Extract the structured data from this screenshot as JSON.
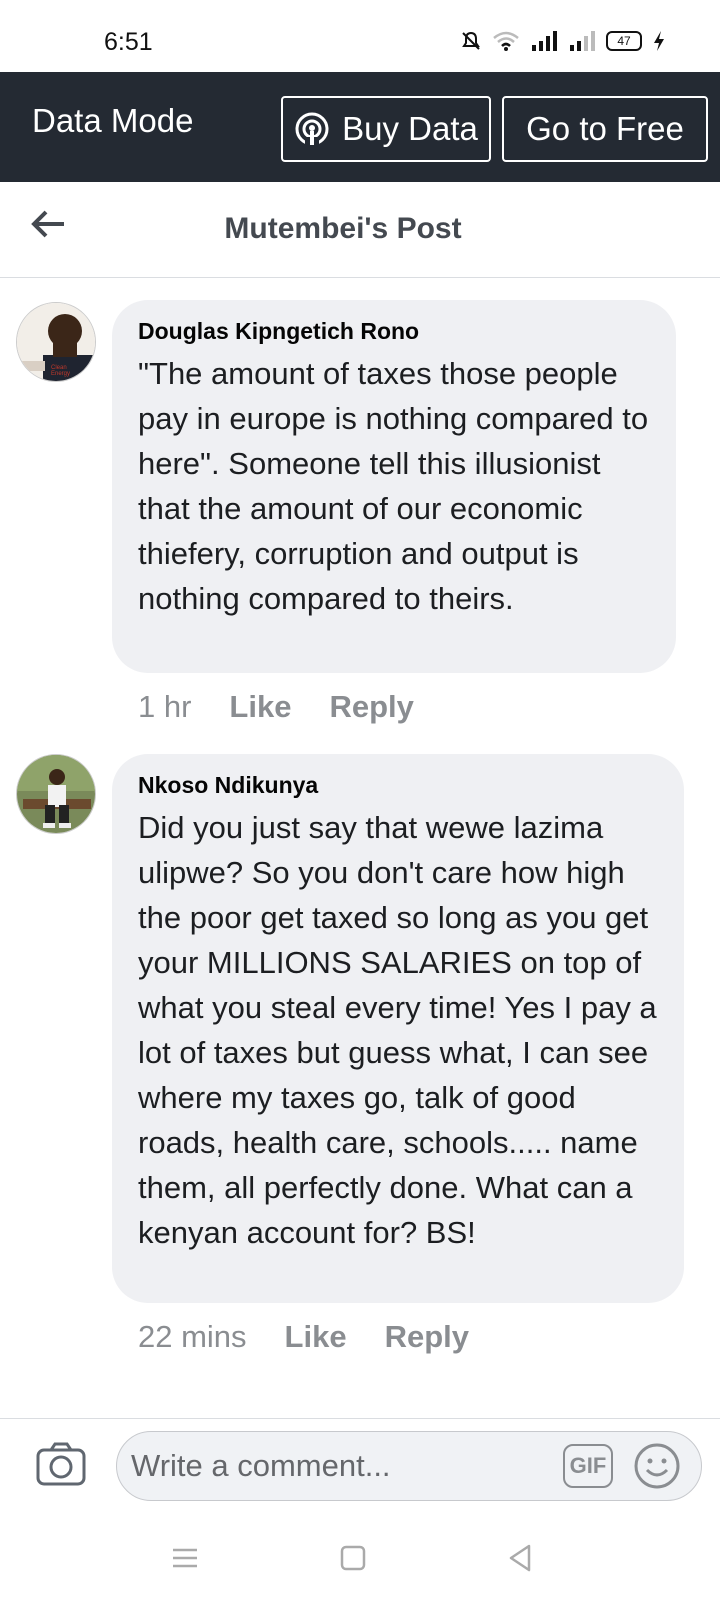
{
  "status_bar": {
    "time": "6:51",
    "battery": "47"
  },
  "data_mode": {
    "title": "Data Mode",
    "buy_label": "Buy Data",
    "free_label": "Go to Free"
  },
  "header": {
    "title": "Mutembei's Post"
  },
  "comments": [
    {
      "author": "Douglas Kipngetich Rono",
      "text": "\"The amount of taxes those people pay in europe is nothing compared to here\". Someone tell this illusionist that the amount of our economic thiefery, corruption and output is nothing compared to theirs.",
      "time": "1 hr",
      "like_label": "Like",
      "reply_label": "Reply"
    },
    {
      "author": "Nkoso Ndikunya",
      "text": "Did you just say that wewe lazima ulipwe? So you don't care how high the poor get taxed so long as you get your MILLIONS SALARIES on top of what you steal every time! Yes I pay a lot of taxes but guess what, I can see where my taxes go, talk of good roads, health care, schools..... name them, all perfectly done. What can a kenyan account for? BS!",
      "time": "22 mins",
      "like_label": "Like",
      "reply_label": "Reply"
    }
  ],
  "composer": {
    "placeholder": "Write a comment...",
    "gif_label": "GIF"
  },
  "icons": {
    "back": "back-arrow-icon",
    "camera": "camera-icon",
    "emoji": "emoji-icon",
    "broadcast": "broadcast-icon"
  },
  "colors": {
    "data_bar_bg": "#242a33",
    "bubble_bg": "#eff0f3",
    "meta_text": "#8a8d91"
  }
}
